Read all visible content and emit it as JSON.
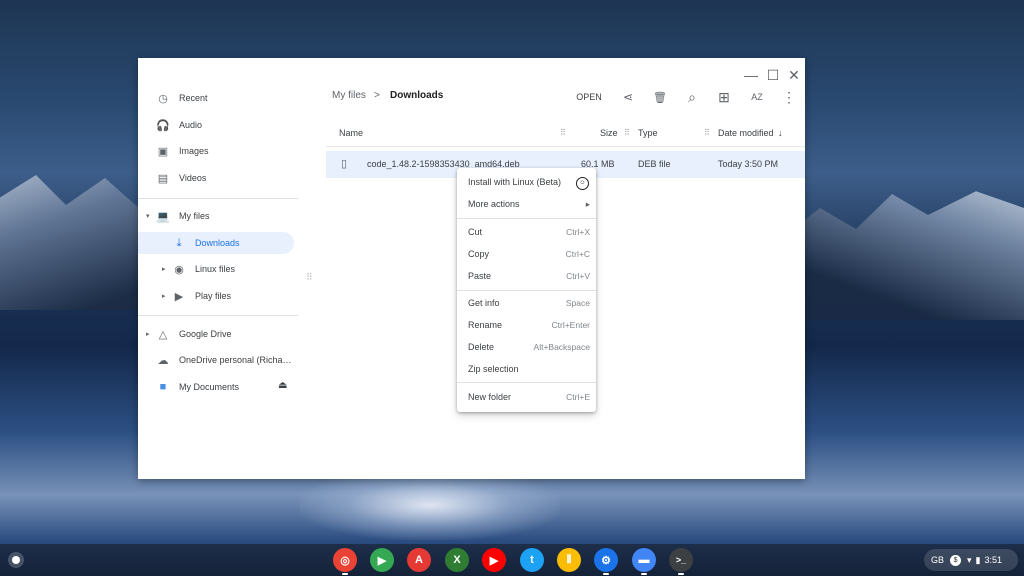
{
  "window": {
    "controls": {
      "minimize": "—",
      "maximize": "☐",
      "close": "✕"
    }
  },
  "sidebar": {
    "items": [
      {
        "label": "Recent",
        "icon": "clock-icon",
        "glyph": "◷"
      },
      {
        "label": "Audio",
        "icon": "headphones-icon",
        "glyph": "🎧"
      },
      {
        "label": "Images",
        "icon": "image-icon",
        "glyph": "▣"
      },
      {
        "label": "Videos",
        "icon": "film-icon",
        "glyph": "▤"
      },
      {
        "label": "My files",
        "icon": "laptop-icon",
        "glyph": "💻"
      },
      {
        "label": "Downloads",
        "icon": "download-icon",
        "glyph": "⤓"
      },
      {
        "label": "Linux files",
        "icon": "penguin-icon",
        "glyph": "◉"
      },
      {
        "label": "Play files",
        "icon": "play-icon",
        "glyph": "▶"
      },
      {
        "label": "Google Drive",
        "icon": "drive-icon",
        "glyph": "△"
      },
      {
        "label": "OneDrive personal (Richa…",
        "icon": "onedrive-icon",
        "glyph": "☁"
      },
      {
        "label": "My Documents",
        "icon": "folder-icon",
        "glyph": "■"
      }
    ],
    "eject_glyph": "⏏"
  },
  "breadcrumb": {
    "parent": "My files",
    "separator": ">",
    "current": "Downloads"
  },
  "toolbar": {
    "open_label": "OPEN",
    "share_glyph": "⋖",
    "delete_glyph": "🗑",
    "search_glyph": "⌕",
    "grid_glyph": "⊞",
    "sort_glyph": "AZ",
    "more_glyph": "⋮"
  },
  "columns": {
    "name": "Name",
    "size": "Size",
    "type": "Type",
    "date": "Date modified",
    "sort_arrow": "↓"
  },
  "file": {
    "name": "code_1.48.2-1598353430_amd64.deb",
    "size": "60.1 MB",
    "type": "DEB file",
    "date": "Today 3:50 PM"
  },
  "context_menu": {
    "install": "Install with Linux (Beta)",
    "more_actions": "More actions",
    "submenu_arrow": "▸",
    "cut": "Cut",
    "cut_sc": "Ctrl+X",
    "copy": "Copy",
    "copy_sc": "Ctrl+C",
    "paste": "Paste",
    "paste_sc": "Ctrl+V",
    "get_info": "Get info",
    "get_info_sc": "Space",
    "rename": "Rename",
    "rename_sc": "Ctrl+Enter",
    "delete": "Delete",
    "delete_sc": "Alt+Backspace",
    "zip": "Zip selection",
    "new_folder": "New folder",
    "new_folder_sc": "Ctrl+E"
  },
  "shelf": {
    "apps": [
      {
        "name": "chrome",
        "color": "#ea4335",
        "glyph": "◎"
      },
      {
        "name": "play-store",
        "color": "#34a853",
        "glyph": "▶"
      },
      {
        "name": "acrobat",
        "color": "#e53935",
        "glyph": "A"
      },
      {
        "name": "xbox",
        "color": "#2e7d32",
        "glyph": "X"
      },
      {
        "name": "youtube",
        "color": "#ff0000",
        "glyph": "▶"
      },
      {
        "name": "twitter",
        "color": "#1da1f2",
        "glyph": "t"
      },
      {
        "name": "podcasts",
        "color": "#fbbc04",
        "glyph": "⦀"
      },
      {
        "name": "settings",
        "color": "#1a73e8",
        "glyph": "⚙"
      },
      {
        "name": "files",
        "color": "#4285f4",
        "glyph": "▬"
      },
      {
        "name": "terminal",
        "color": "#3c4043",
        "glyph": ">_"
      }
    ],
    "tray": {
      "keyboard": "GB",
      "badge": "$",
      "wifi": "▾",
      "battery": "▮",
      "time": "3:51"
    }
  }
}
